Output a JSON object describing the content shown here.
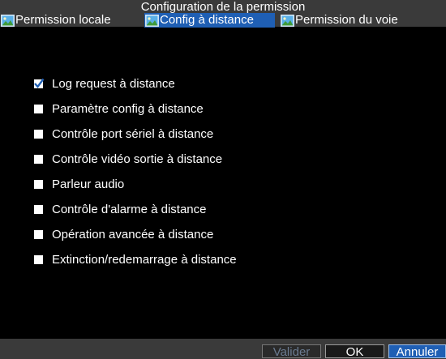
{
  "window": {
    "title": "Configuration de la permission"
  },
  "tabs": [
    {
      "label": "Permission locale",
      "icon": "landscape-picture-icon",
      "active": false
    },
    {
      "label": "Config à distance",
      "icon": "landscape-picture-icon",
      "active": true
    },
    {
      "label": "Permission du voie",
      "icon": "landscape-picture-icon",
      "active": false
    }
  ],
  "permissions": [
    {
      "label": "Log request à distance",
      "checked": true
    },
    {
      "label": "Paramètre config à distance",
      "checked": false
    },
    {
      "label": "Contrôle port sériel à distance",
      "checked": false
    },
    {
      "label": "Contrôle vidéo sortie à distance",
      "checked": false
    },
    {
      "label": "Parleur audio",
      "checked": false
    },
    {
      "label": "Contrôle d'alarme à distance",
      "checked": false
    },
    {
      "label": "Opération avancée à distance",
      "checked": false
    },
    {
      "label": "Extinction/redemarrage à distance",
      "checked": false
    }
  ],
  "buttons": {
    "validate_label": "Valider",
    "ok_label": "OK",
    "cancel_label": "Annuler"
  },
  "colors": {
    "background": "#000000",
    "bar": "#3a3a3a",
    "accent": "#1f5fb4",
    "check": "#1f5fb4"
  }
}
